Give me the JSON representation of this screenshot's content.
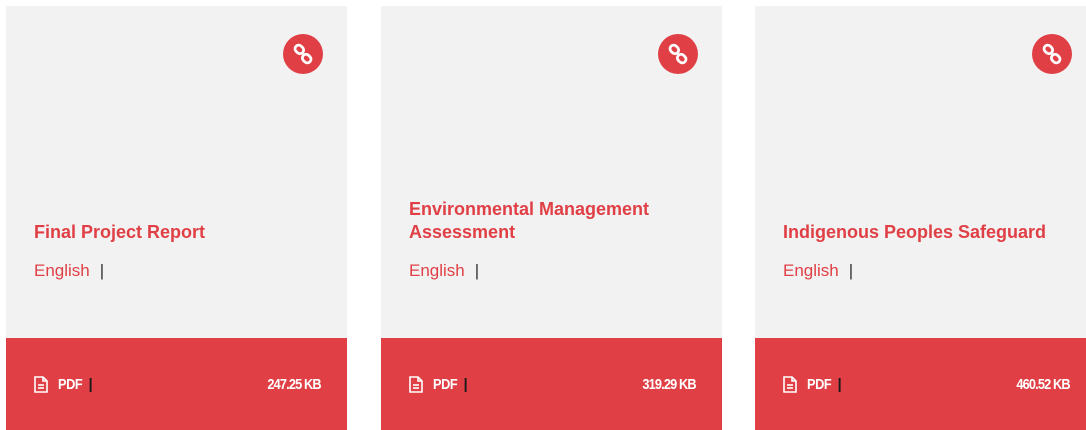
{
  "colors": {
    "accent": "#e04045",
    "card_background": "#f2f2f3",
    "text_dark": "#333333"
  },
  "cards": [
    {
      "title": "Final Project Report",
      "language": "English",
      "separator": "|",
      "file_type": "PDF",
      "file_separator": "|",
      "file_size": "247.25 KB",
      "link_icon": "link-icon",
      "file_icon": "document-icon"
    },
    {
      "title": "Environmental Management Assessment",
      "language": "English",
      "separator": "|",
      "file_type": "PDF",
      "file_separator": "|",
      "file_size": "319.29 KB",
      "link_icon": "link-icon",
      "file_icon": "document-icon"
    },
    {
      "title": "Indigenous Peoples Safeguard",
      "language": "English",
      "separator": "|",
      "file_type": "PDF",
      "file_separator": "|",
      "file_size": "460.52 KB",
      "link_icon": "link-icon",
      "file_icon": "document-icon"
    }
  ]
}
